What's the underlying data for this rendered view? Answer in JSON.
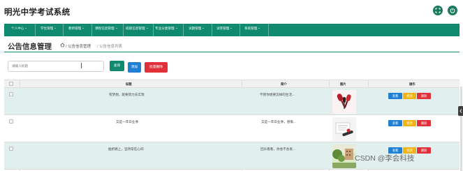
{
  "app": {
    "title": "明光中学考试系统"
  },
  "nav": {
    "items": [
      {
        "label": "个人中心"
      },
      {
        "label": "学生管理"
      },
      {
        "label": "教师管理"
      },
      {
        "label": "课程信息管理"
      },
      {
        "label": "班级信息管理"
      },
      {
        "label": "专业分类管理"
      },
      {
        "label": "试题管理"
      },
      {
        "label": "试卷管理"
      },
      {
        "label": "系统管理"
      }
    ]
  },
  "page": {
    "title": "公告信息管理",
    "breadcrumb": {
      "level1": "/ 公告信息管理",
      "level2": "/ 公告信息列表"
    }
  },
  "toolbar": {
    "search_placeholder": "请输入标题",
    "search_label": "查询",
    "add_label": "添加",
    "batch_delete_label": "批量删除"
  },
  "table": {
    "columns": {
      "title": "标题",
      "summary": "简介",
      "image": "图片",
      "actions": "操作"
    },
    "rows": [
      {
        "title": "有梦想，就要努力去实现",
        "summary": "不管你想要怎样的生活...",
        "view": "查看",
        "edit": "修改",
        "delete": "删除",
        "image_icon": "microphones-image"
      },
      {
        "title": "又是一年毕业季",
        "summary": "又是一年毕业季，感慨...",
        "view": "查看",
        "edit": "修改",
        "delete": "删除",
        "image_icon": "diploma-image"
      },
      {
        "title": "挫折路上，坚持常在心间",
        "summary": "回头看看，你会不会发...",
        "view": "查看",
        "edit": "修改",
        "delete": "删除",
        "image_icon": "campus-image"
      }
    ]
  },
  "watermark": "CSDN @李会科技",
  "colors": {
    "primary": "#0f8a6e",
    "blue": "#1f7fd3",
    "yellow": "#f0b418",
    "red": "#e0303a",
    "row_alt": "#e2efef"
  }
}
